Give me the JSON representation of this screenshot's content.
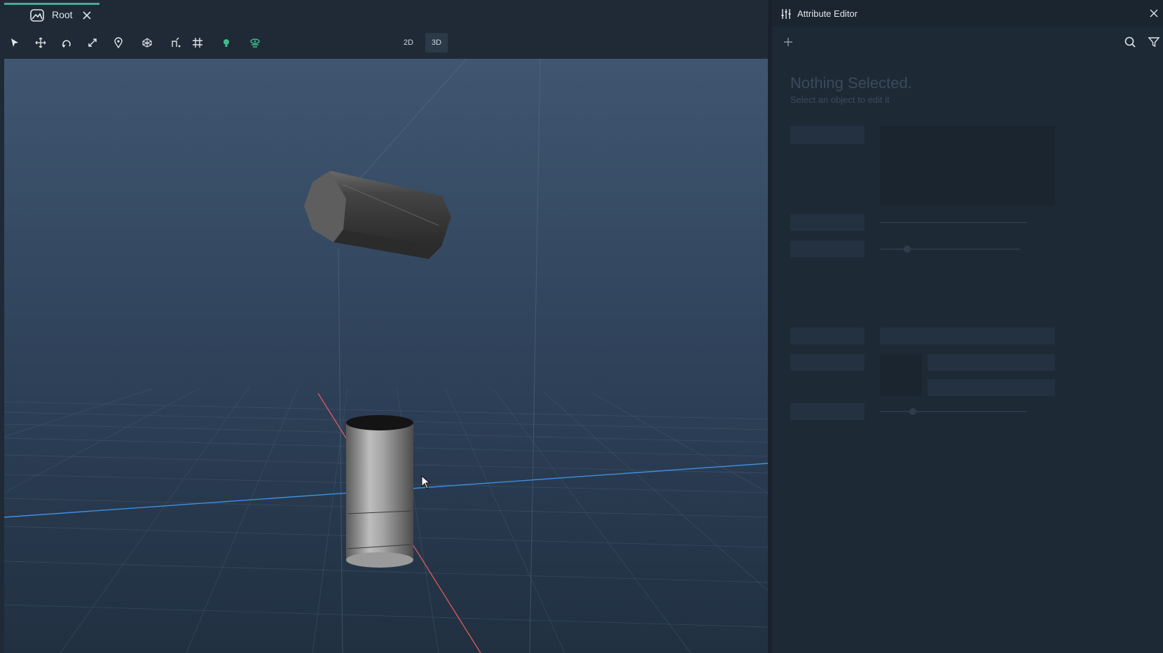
{
  "tab": {
    "label": "Root",
    "icon": "scene-icon",
    "accent_color": "#4aa7a0"
  },
  "toolbar": {
    "tools": [
      "select-arrow-icon",
      "move-icon",
      "rotate-icon",
      "scale-icon",
      "pin-icon",
      "transform-gizmo-icon",
      "snap-icon",
      "grid-icon",
      "light-bulb-icon",
      "camera-view-icon"
    ],
    "mode_2d_label": "2D",
    "mode_3d_label": "3D",
    "active_mode": "3D"
  },
  "attribute_editor": {
    "title": "Attribute Editor",
    "empty_title": "Nothing Selected.",
    "empty_subtitle": "Select an object to edit it"
  },
  "colors": {
    "viewport_top": "#405670",
    "viewport_bottom": "#213041",
    "x_axis": "#e05a5a",
    "z_axis": "#3f8fe0"
  }
}
